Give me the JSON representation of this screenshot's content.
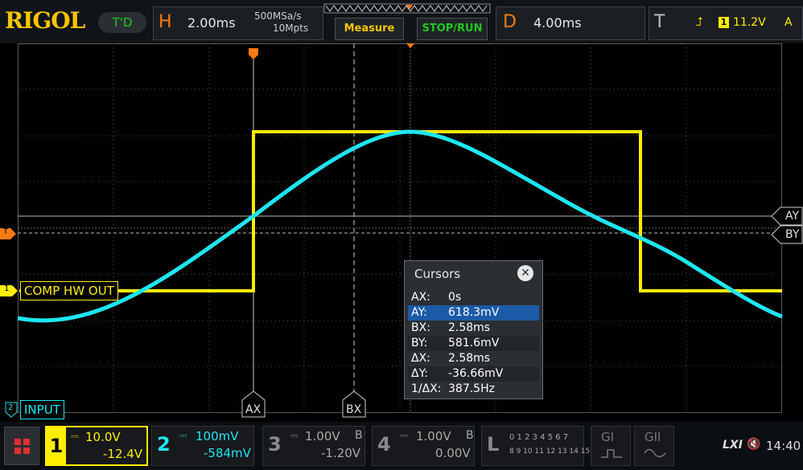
{
  "header": {
    "logo": "RIGOL",
    "trigger_status": "T'D",
    "horizontal": {
      "letter": "H",
      "timebase": "2.00ms",
      "sample_rate": "500MSa/s",
      "memory_depth": "10Mpts"
    },
    "measure_label": "Measure",
    "stop_run_label": "STOP/RUN",
    "delay": {
      "letter": "D",
      "value": "4.00ms"
    },
    "trigger": {
      "letter": "T",
      "source": "1",
      "level": "11.2V",
      "mode": "A"
    }
  },
  "waveform": {
    "trigger_marker": "T",
    "ch1_marker": "1",
    "ch1_label": "COMP HW OUT",
    "ch2_marker": "2",
    "ch2_label": "INPUT",
    "cursor_ax_label": "AX",
    "cursor_bx_label": "BX",
    "cursor_ay_label": "AY",
    "cursor_by_label": "BY"
  },
  "cursors": {
    "title": "Cursors",
    "close": "✕",
    "rows": [
      {
        "key": "AX:",
        "value": "0s"
      },
      {
        "key": "AY:",
        "value": "618.3mV"
      },
      {
        "key": "BX:",
        "value": "2.58ms"
      },
      {
        "key": "BY:",
        "value": "581.6mV"
      },
      {
        "key": "ΔX:",
        "value": "2.58ms"
      },
      {
        "key": "ΔY:",
        "value": "-36.66mV"
      },
      {
        "key": "1/ΔX:",
        "value": "387.5Hz"
      }
    ]
  },
  "channels": [
    {
      "num": "1",
      "scale": "10.0V",
      "offset": "-12.4V",
      "color": "#ffee00"
    },
    {
      "num": "2",
      "scale": "100mV",
      "offset": "-584mV",
      "color": "#1ee6f0"
    },
    {
      "num": "3",
      "scale": "1.00V",
      "coupling": "B",
      "offset": "-1.20V",
      "color": "#aaaaaa"
    },
    {
      "num": "4",
      "scale": "1.00V",
      "coupling": "B",
      "offset": "0.00V",
      "color": "#aaaaaa"
    }
  ],
  "logic": {
    "letter": "L",
    "row1": "0 1 2 3  4 5 6 7",
    "row2": "8 9 10 11 12 13 14 15"
  },
  "gen1_label": "GI",
  "gen2_label": "GII",
  "status": {
    "lxi": "LXI",
    "time": "14:40"
  }
}
